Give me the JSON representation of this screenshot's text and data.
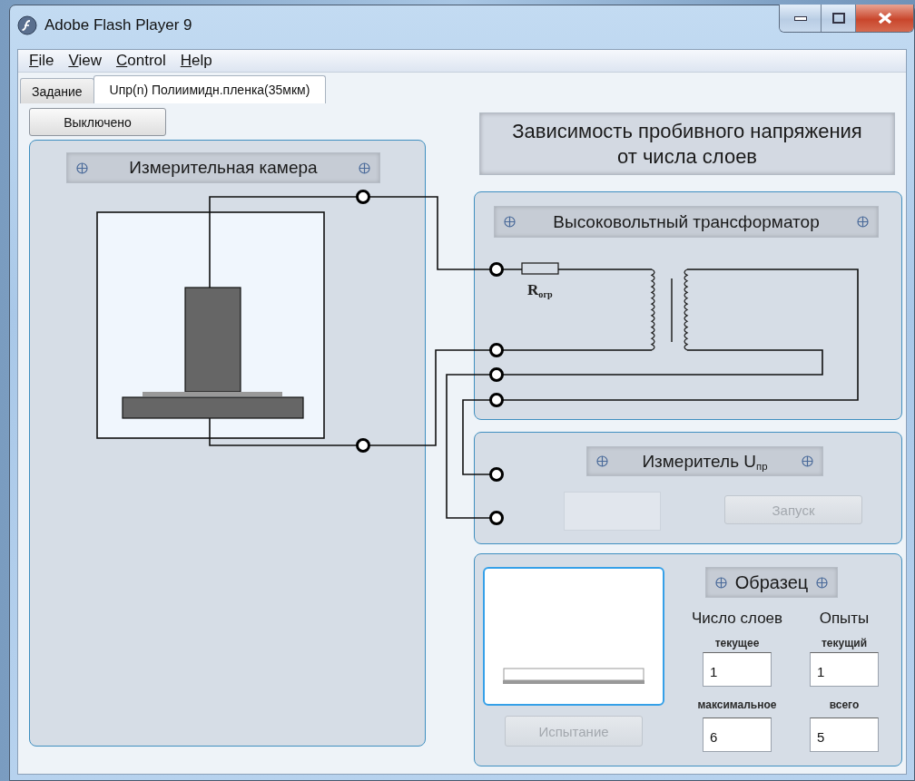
{
  "window": {
    "title": "Adobe Flash Player 9"
  },
  "menu": [
    "File",
    "View",
    "Control",
    "Help"
  ],
  "tabs": [
    {
      "label": "Задание",
      "selected": false
    },
    {
      "label": "Uпр(n) Полиимидн.пленка(35мкм)",
      "selected": true
    }
  ],
  "power_button": {
    "label": "Выключено"
  },
  "chart_title": [
    "Зависимость пробивного напряжения",
    "от числа слоев"
  ],
  "camera": {
    "title": "Измерительная камера"
  },
  "transformer": {
    "title": "Высоковольтный трансформатор",
    "resistor_label": "R$_{огр}$"
  },
  "meter": {
    "title": "Измеритель U$_{пр}$",
    "start_button": {
      "label": "Запуск",
      "disabled": true
    }
  },
  "sample": {
    "title": "Образец",
    "test_button": {
      "label": "Испытание",
      "disabled": true
    },
    "layers": {
      "heading": "Число слоев",
      "current_label": "текущее",
      "current": "1",
      "max_label": "максимальное",
      "max": "6"
    },
    "trials": {
      "heading": "Опыты",
      "current_label": "текущий",
      "current": "1",
      "total_label": "всего",
      "total": "5"
    }
  }
}
